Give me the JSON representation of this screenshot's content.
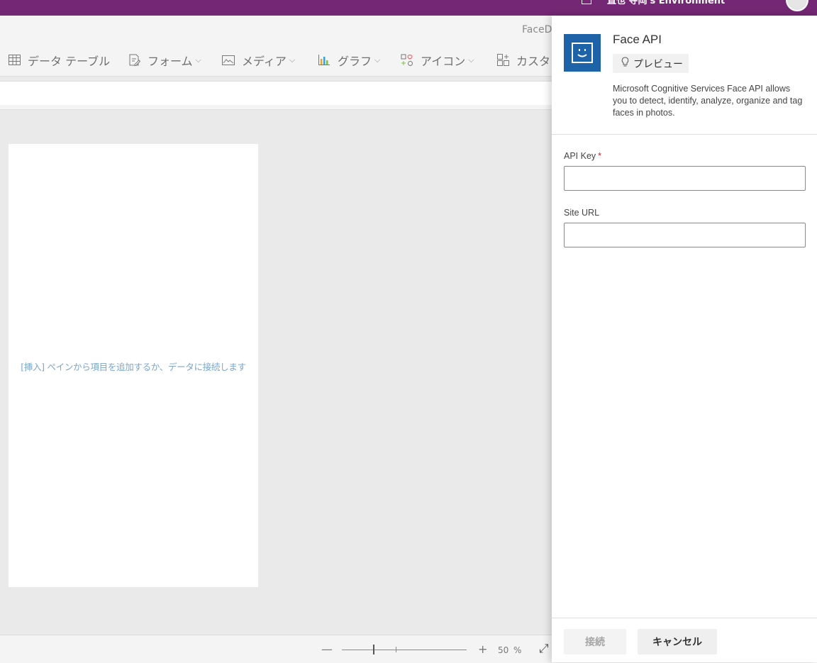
{
  "header": {
    "environment": "直也 寺岡's Environment"
  },
  "app": {
    "title": "FaceD"
  },
  "ribbon": {
    "items": [
      {
        "label": "データ テーブル",
        "icon": "table-icon",
        "has_dropdown": false
      },
      {
        "label": "フォーム",
        "icon": "form-icon",
        "has_dropdown": true
      },
      {
        "label": "メディア",
        "icon": "media-icon",
        "has_dropdown": true
      },
      {
        "label": "グラフ",
        "icon": "chart-icon",
        "has_dropdown": true
      },
      {
        "label": "アイコン",
        "icon": "icons-icon",
        "has_dropdown": true
      },
      {
        "label": "カスタ",
        "icon": "custom-icon",
        "has_dropdown": false
      }
    ],
    "chevron": "⌵"
  },
  "canvas": {
    "hint": "[挿入] ペインから項目を追加するか、データに接続します"
  },
  "statusbar": {
    "zoom_minus": "—",
    "zoom_plus": "+",
    "zoom_value": "50",
    "zoom_unit": "%",
    "zoom_level": 0.25
  },
  "panel": {
    "title": "Face API",
    "badge": "プレビュー",
    "description": "Microsoft Cognitive Services Face API allows you to detect, identify, analyze, organize and tag faces in photos.",
    "fields": [
      {
        "label": "API Key",
        "required": true,
        "value": "",
        "required_mark": "*"
      },
      {
        "label": "Site URL",
        "required": false,
        "value": ""
      }
    ],
    "buttons": {
      "connect": "接続",
      "cancel": "キャンセル"
    }
  },
  "colors": {
    "top_bar": "#742774",
    "logo_bg": "#1e62a8",
    "hint_text": "#7aa6cf",
    "required": "#c4262e"
  }
}
